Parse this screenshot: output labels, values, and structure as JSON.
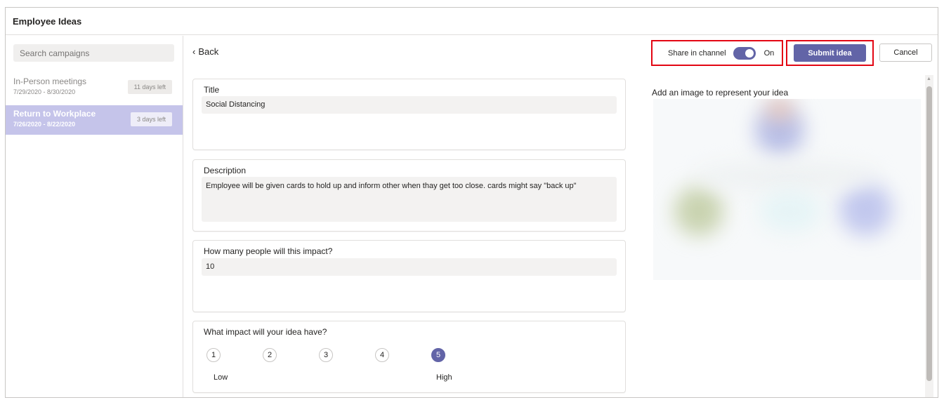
{
  "app": {
    "title": "Employee Ideas"
  },
  "sidebar": {
    "search_placeholder": "Search campaigns",
    "campaigns": [
      {
        "name": "In-Person meetings",
        "dates": "7/29/2020 - 8/30/2020",
        "badge": "11 days left",
        "active": false
      },
      {
        "name": "Return to Workplace",
        "dates": "7/26/2020 - 8/22/2020",
        "badge": "3 days left",
        "active": true
      }
    ]
  },
  "header": {
    "back_label": "Back",
    "share_label": "Share in channel",
    "share_state": "On",
    "submit_label": "Submit idea",
    "cancel_label": "Cancel"
  },
  "form": {
    "title": {
      "label": "Title",
      "value": "Social Distancing"
    },
    "description": {
      "label": "Description",
      "value": "Employee will be given cards to hold up and inform other when thay get too close. cards might say \"back up\""
    },
    "impact_people": {
      "label": "How many people will this impact?",
      "value": "10"
    },
    "impact_scale": {
      "label": "What impact will your idea have?",
      "options": [
        "1",
        "2",
        "3",
        "4",
        "5"
      ],
      "selected": "5",
      "low_label": "Low",
      "high_label": "High"
    }
  },
  "image_section": {
    "label": "Add an image to represent your idea"
  },
  "colors": {
    "accent": "#6264a7",
    "highlight_border": "#e30613",
    "active_campaign_bg": "#c5c4ea"
  }
}
